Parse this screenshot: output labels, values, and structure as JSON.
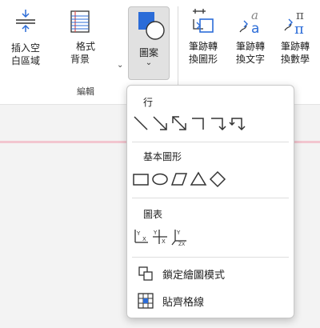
{
  "ribbon": {
    "insert_space": {
      "line1": "插入空",
      "line2": "白區域",
      "icon": "insert-space-icon"
    },
    "format_background": {
      "line1": "格式",
      "line2": "背景",
      "icon": "ruled-lines-icon"
    },
    "shapes": {
      "label": "圖案",
      "icon": "shapes-icon"
    },
    "ink_to_shape": {
      "line1": "筆跡轉",
      "line2": "換圖形",
      "icon": "ink-to-shape-icon"
    },
    "ink_to_text": {
      "line1": "筆跡轉",
      "line2": "換文字",
      "icon": "ink-to-text-icon"
    },
    "ink_to_math": {
      "line1": "筆跡轉",
      "line2": "換數學",
      "icon": "ink-to-math-icon"
    },
    "group_label": "編輯"
  },
  "menu": {
    "lines_title": "行",
    "basic_shapes_title": "基本圖形",
    "graphs_title": "圖表",
    "lock_drawing_mode": "鎖定繪圖模式",
    "snap_to_grid": "貼齊格線"
  },
  "colors": {
    "accent": "#2b6cd8",
    "selected_bg": "#e1e1e1",
    "page_line": "#f2c6cf"
  }
}
